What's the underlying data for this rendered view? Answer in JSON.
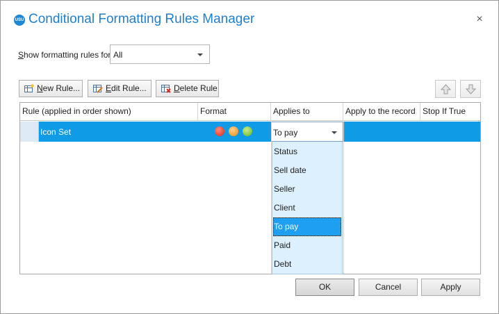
{
  "window": {
    "icon_text": "USU",
    "title": "Conditional Formatting Rules Manager",
    "close_glyph": "×"
  },
  "filter": {
    "label_prefix": "S",
    "label_rest": "how formatting rules for:",
    "value": "All"
  },
  "toolbar": {
    "new_rule_u": "N",
    "new_rule_rest": "ew Rule...",
    "edit_rule_u": "E",
    "edit_rule_rest": "dit Rule...",
    "delete_rule_u": "D",
    "delete_rule_rest": "elete Rule",
    "move_up_icon": "arrow-up-icon",
    "move_down_icon": "arrow-down-icon"
  },
  "grid": {
    "columns": [
      "Rule (applied in order shown)",
      "Format",
      "Applies to",
      "Apply to the record",
      "Stop If True"
    ],
    "rows": [
      {
        "rule": "Icon Set",
        "format_icons": [
          "red-circle-icon",
          "orange-circle-icon",
          "green-circle-icon"
        ],
        "applies_to": "To pay"
      }
    ]
  },
  "applies_to_options": [
    "Status",
    "Sell date",
    "Seller",
    "Client",
    "To pay",
    "Paid",
    "Debt"
  ],
  "applies_to_selected": "To pay",
  "footer": {
    "ok": "OK",
    "cancel": "Cancel",
    "apply": "Apply"
  },
  "colors": {
    "title": "#1e7fd0",
    "selected_row": "#0f9be6",
    "dropdown_bg": "#ddf0fd",
    "selected_option": "#1e9ff2"
  }
}
